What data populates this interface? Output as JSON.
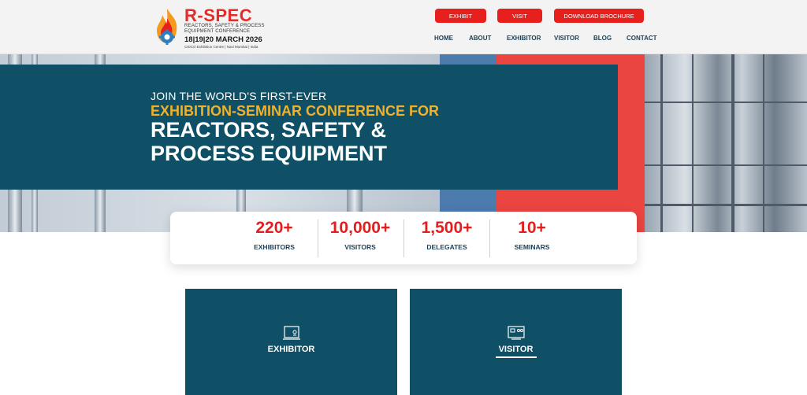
{
  "brand": {
    "name": "R-SPEC",
    "subtitle": "Reactors, Safety & Process Equipment Conference",
    "dates": "18|19|20 MARCH 2026",
    "venue": "CIDCO Exhibition Centre | Navi Mumbai | India"
  },
  "header_buttons": [
    "EXHIBIT",
    "VISIT",
    "DOWNLOAD BROCHURE"
  ],
  "nav": [
    "HOME",
    "ABOUT",
    "EXHIBITOR",
    "VISITOR",
    "BLOG",
    "CONTACT"
  ],
  "hero": {
    "line1": "JOIN THE WORLD'S FIRST-EVER",
    "line2": "EXHIBITION-SEMINAR CONFERENCE FOR",
    "line3": "REACTORS, SAFETY &",
    "line4": "PROCESS EQUIPMENT"
  },
  "stats": [
    {
      "value": "220+",
      "label": "EXHIBITORS"
    },
    {
      "value": "10,000+",
      "label": "VISITORS"
    },
    {
      "value": "1,500+",
      "label": "DELEGATES"
    },
    {
      "value": "10+",
      "label": "SEMINARS"
    }
  ],
  "cards": [
    {
      "label": "EXHIBITOR",
      "icon": "exhibitor-booth-icon"
    },
    {
      "label": "VISITOR",
      "icon": "visitor-screen-icon"
    }
  ],
  "colors": {
    "accent_red": "#e8201d",
    "teal": "#0f5066",
    "gold": "#f0b12b",
    "navy_text": "#1d3f53"
  }
}
